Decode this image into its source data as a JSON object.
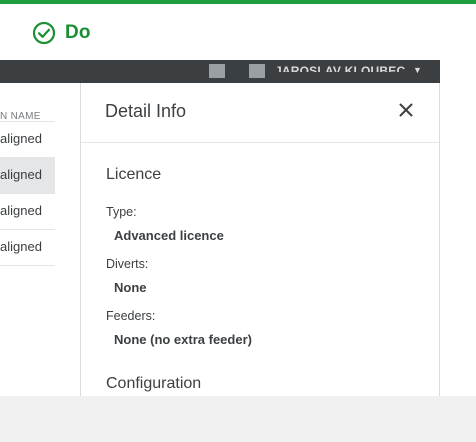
{
  "header": {
    "title": "Do",
    "accent": "#1f9d3f"
  },
  "topbar": {
    "user_name": "JAROSLAV KLOUBEC",
    "chevron": "▼"
  },
  "list": {
    "column_header": "N NAME",
    "rows": [
      {
        "label": "aligned",
        "selected": false
      },
      {
        "label": "aligned",
        "selected": true
      },
      {
        "label": "aligned",
        "selected": false
      },
      {
        "label": "aligned",
        "selected": false
      }
    ]
  },
  "detail": {
    "title": "Detail Info",
    "licence_section": "Licence",
    "type_label": "Type:",
    "type_value": "Advanced licence",
    "diverts_label": "Diverts:",
    "diverts_value": "None",
    "feeders_label": "Feeders:",
    "feeders_value": "None (no extra feeder)",
    "configuration_section": "Configuration"
  }
}
